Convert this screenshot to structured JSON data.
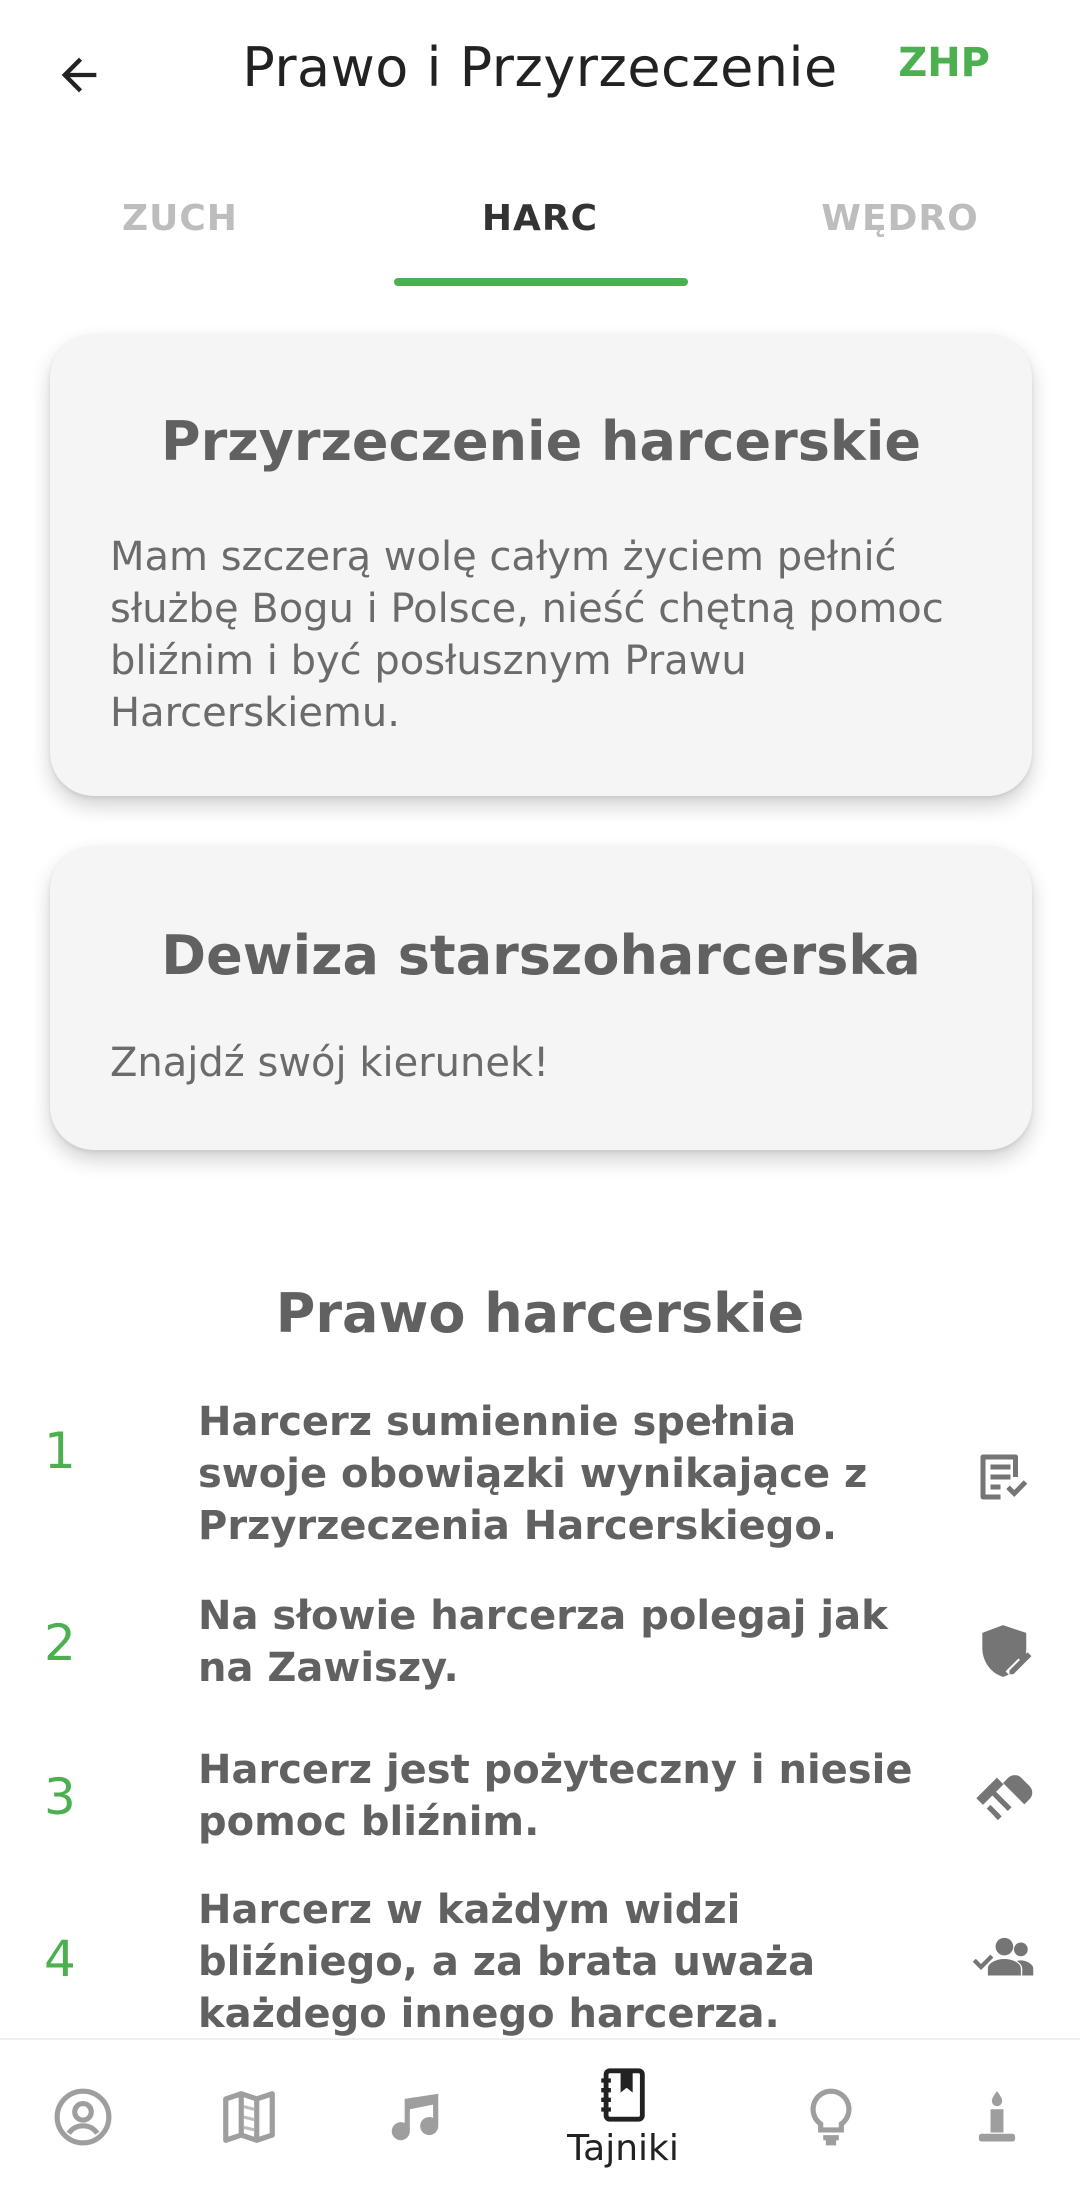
{
  "appbar": {
    "title": "Prawo i Przyrzeczenie",
    "brand": "ZHP"
  },
  "tabs": [
    {
      "label": "ZUCH"
    },
    {
      "label": "HARC"
    },
    {
      "label": "WĘDRO"
    }
  ],
  "promise_card": {
    "title": "Przyrzeczenie harcerskie",
    "text": "Mam szczerą wolę całym życiem pełnić służbę Bogu i Polsce, nieść chętną pomoc bliźnim i być posłusznym Prawu Harcerskiemu."
  },
  "motto_card": {
    "title": "Dewiza starszoharcerska",
    "text": "Znajdź swój kierunek!"
  },
  "law": {
    "title": "Prawo harcerskie",
    "items": [
      {
        "number": "1",
        "text": "Harcerz sumiennie spełnia swoje obowiązki wynikające z Przyrzeczenia Harcerskiego.",
        "icon": "checklist-icon"
      },
      {
        "number": "2",
        "text": "Na słowie harcerza polegaj jak na Zawiszy.",
        "icon": "shield-edit-icon"
      },
      {
        "number": "3",
        "text": "Harcerz jest pożyteczny i niesie pomoc bliźnim.",
        "icon": "handshake-icon"
      },
      {
        "number": "4",
        "text": "Harcerz w każdym widzi bliźniego, a za brata uważa każdego innego harcerza.",
        "icon": "group-check-icon"
      }
    ]
  },
  "bottom_nav": {
    "active_label": "Tajniki",
    "items": [
      "profile-icon",
      "map-icon",
      "music-icon",
      "notebook-icon",
      "lightbulb-icon",
      "candle-icon"
    ]
  },
  "colors": {
    "accent": "#4caf50",
    "card_bg": "#f5f5f5",
    "text": "#616161"
  }
}
